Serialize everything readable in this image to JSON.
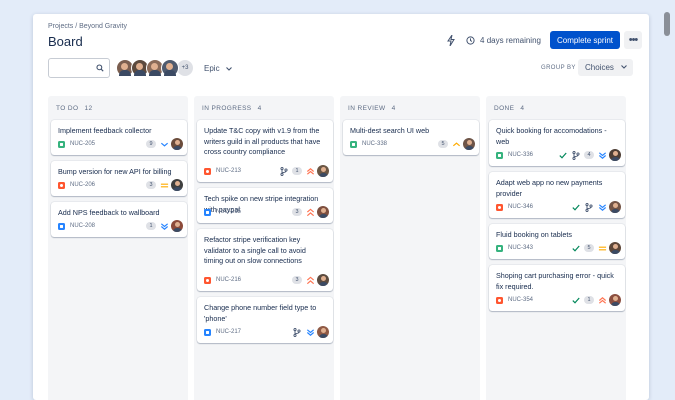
{
  "breadcrumb": "Projects / Beyond Gravity",
  "title": "Board",
  "header": {
    "time_remaining": "4 days remaining",
    "complete_sprint_label": "Complete sprint",
    "more_label": "•••"
  },
  "filters": {
    "search_placeholder": "",
    "avatars": [
      {
        "name": "avatar-1",
        "color": "#7b5e4f"
      },
      {
        "name": "avatar-2",
        "color": "#5c4a3e"
      },
      {
        "name": "avatar-3",
        "color": "#8a6a58"
      },
      {
        "name": "avatar-4",
        "color": "#4e5a6e"
      }
    ],
    "more_avatars": "+3",
    "epic_label": "Epic",
    "group_by_label": "GROUP BY",
    "group_by_value": "Choices"
  },
  "colors": {
    "primary": "#0052cc",
    "story": "#36b37e",
    "task": "#2684ff",
    "bug": "#ff5630",
    "priority_high": "#ff7452",
    "priority_medium": "#ffab00",
    "priority_low": "#2684ff",
    "done_check": "#00875a"
  },
  "columns": [
    {
      "title": "TO DO",
      "count": "12",
      "cards": [
        {
          "title": "Implement feedback collector",
          "type": "story",
          "key": "NUC-205",
          "estimate": "9",
          "priority": "low",
          "avatar": "#6b4c3b"
        },
        {
          "title": "Bump version for new API for billing",
          "type": "bug",
          "key": "NUC-206",
          "estimate": "3",
          "priority": "medium",
          "avatar": "#3f3f3f"
        },
        {
          "title": "Add NPS feedback to wallboard",
          "type": "task",
          "key": "NUC-208",
          "estimate": "1",
          "priority": "lowest",
          "avatar": "#8c4a3a"
        }
      ]
    },
    {
      "title": "IN PROGRESS",
      "count": "4",
      "cards": [
        {
          "title": "Update T&C copy with v1.9 from the writers guild in all products that have cross country compliance",
          "type": "bug",
          "key": "NUC-213",
          "estimate": "1",
          "priority": "highest",
          "branch": true,
          "avatar": "#6a5644"
        },
        {
          "title": "Tech spike on new stripe integration with paypal",
          "type": "task",
          "key": "NUC-215",
          "estimate": "3",
          "priority": "high",
          "avatar": "#7d4f3f"
        },
        {
          "title": "Refactor stripe verification key validator to a single call to avoid timing out on slow connections",
          "type": "bug",
          "key": "NUC-216",
          "estimate": "3",
          "priority": "high",
          "avatar": "#5b4b3f"
        },
        {
          "title": "Change phone number field type to 'phone'",
          "type": "task",
          "key": "NUC-217",
          "priority": "lowest",
          "branch": true,
          "avatar": "#8f5a45"
        }
      ]
    },
    {
      "title": "IN REVIEW",
      "count": "4",
      "cards": [
        {
          "title": "Multi-dest search UI web",
          "type": "story",
          "key": "NUC-338",
          "estimate": "5",
          "priority": "medium-up",
          "avatar": "#6e5548"
        }
      ]
    },
    {
      "title": "DONE",
      "count": "4",
      "cards": [
        {
          "title": "Quick booking for accomodations - web",
          "type": "story",
          "key": "NUC-336",
          "estimate": "4",
          "priority": "lowest",
          "done": true,
          "branch": true,
          "avatar": "#4d3e35"
        },
        {
          "title": "Adapt web app no new payments provider",
          "type": "bug",
          "key": "NUC-346",
          "priority": "lowest",
          "done": true,
          "branch": true,
          "avatar": "#735446"
        },
        {
          "title": "Fluid booking on tablets",
          "type": "story",
          "key": "NUC-343",
          "estimate": "5",
          "priority": "medium",
          "done": true,
          "avatar": "#5d4638"
        },
        {
          "title": "Shoping cart purchasing error - quick fix required.",
          "type": "bug",
          "key": "NUC-354",
          "estimate": "1",
          "priority": "highest",
          "done": true,
          "avatar": "#8b4e3f"
        }
      ]
    }
  ]
}
